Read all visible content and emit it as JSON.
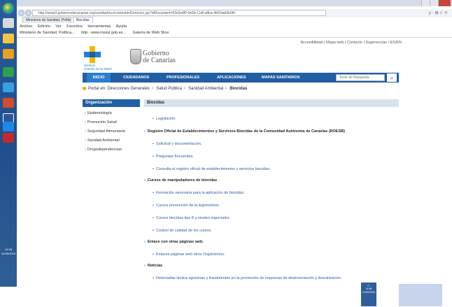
{
  "browser": {
    "address_url": "http://www3.gobiernodecanarias.org/sanidad/scs/contenidoGenerico.jsp?idDocument=53c0e4f0-0e5b-11df-a8ba-4fd2dab9b0fd",
    "right_controls": "ρ - ⊠ ⊂ ✕",
    "tabs": [
      "Ministerio de Sanidad, Política ...",
      "Biocidas"
    ],
    "menu": [
      "Archivo",
      "Edición",
      "Ver",
      "Favoritos",
      "Herramientas",
      "Ayuda"
    ],
    "favorites": [
      "Ministerio de Sanidad, Política...",
      "http - www.msssi.gob.es...",
      "Galería de Web Slice"
    ]
  },
  "taskbar": {
    "tray_time": "14:08",
    "tray_date": "01/06/2016"
  },
  "site": {
    "top_links": "Accesibilidad | Mapa web | Contacto | Sugerencias | ES/EN",
    "logo_small": [
      "Servicio",
      "Canario de la Salud"
    ],
    "logo_gobierno": [
      "Gobierno",
      "de Canarias"
    ],
    "nav": [
      {
        "label": "INICIO"
      },
      {
        "label": "CIUDADANOS"
      },
      {
        "label": "PROFESIONALES"
      },
      {
        "label": "APLICACIONES"
      },
      {
        "label": "MAPAS SANITARIOS"
      }
    ],
    "search_placeholder": "Texto de Búsqueda ...",
    "breadcrumb": [
      "Portal en:",
      "Direcciones Generales",
      "Salud Pública",
      "Sanidad Ambiental",
      "Biocidas"
    ],
    "sidebar": {
      "title": "Organización",
      "items": [
        "Epidemiología",
        "Promoción Salud",
        "Seguridad Alimentaria",
        "Sanidad Ambiental",
        "Drogodependencias"
      ]
    },
    "content": {
      "title": "Biocidas",
      "items": [
        {
          "kind": "link",
          "text": "Legislación"
        },
        {
          "kind": "section",
          "text": "Registro Oficial de Establecimientos y Servicios Biocidas de la Comunidad Autónoma de Canarias (ROESB)"
        },
        {
          "kind": "link",
          "text": "Solicitud y documentación."
        },
        {
          "kind": "link",
          "text": "Preguntas frecuentes."
        },
        {
          "kind": "link",
          "text": "Consulta al registro oficial de establecimientos y servicios biocidas."
        },
        {
          "kind": "section",
          "text": "Cursos de manipuladores de biocidas"
        },
        {
          "kind": "link",
          "text": "Formación necesaria para la aplicación de biocidas."
        },
        {
          "kind": "link",
          "text": "Cursos prevención de la legionelosis."
        },
        {
          "kind": "link",
          "text": "Cursos biocidas tipo 8 y niveles especiales."
        },
        {
          "kind": "link",
          "text": "Control de calidad de los cursos."
        },
        {
          "kind": "section",
          "text": "Enlace con otras páginas web."
        },
        {
          "kind": "link",
          "text": "Enlaces páginas web otros Organismos."
        },
        {
          "kind": "section",
          "text": "Noticias"
        },
        {
          "kind": "link",
          "text": "Detectadas láctica agresivas y fraudulentas en la promoción de empresas de desinsectación y desratización."
        }
      ]
    }
  }
}
